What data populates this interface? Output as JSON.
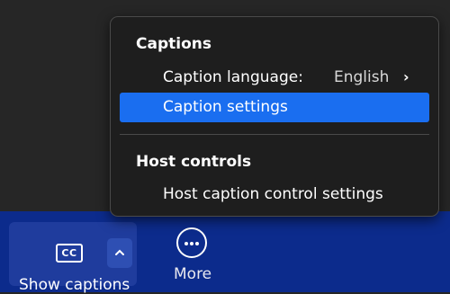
{
  "menu": {
    "captions_header": "Captions",
    "items": [
      {
        "label": "Caption language:",
        "value": "English",
        "icon": "chevron-right-icon"
      },
      {
        "label": "Caption settings",
        "selected": true
      }
    ],
    "host_header": "Host controls",
    "host_items": [
      {
        "label": "Host caption control settings"
      }
    ]
  },
  "toolbar": {
    "show_captions": {
      "label": "Show captions",
      "icon_text": "CC",
      "icon": "closed-captions-icon"
    },
    "caret_icon": "chevron-up-icon",
    "more": {
      "label": "More",
      "icon": "more-icon"
    }
  },
  "colors": {
    "menu_bg": "#1e1e1e",
    "selected": "#1a6ef0",
    "toolbar_bg": "#0c2b8c"
  }
}
